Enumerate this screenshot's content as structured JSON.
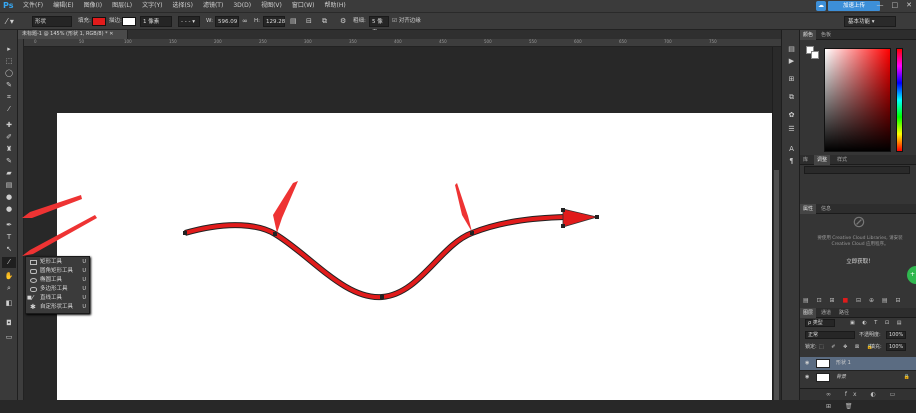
{
  "menubar": {
    "logo": "Ps",
    "items": [
      "文件(F)",
      "编辑(E)",
      "图像(I)",
      "图层(L)",
      "文字(Y)",
      "选择(S)",
      "滤镜(T)",
      "3D(D)",
      "视图(V)",
      "窗口(W)",
      "帮助(H)"
    ],
    "cloud_button": "加速上传",
    "window_controls": [
      "—",
      "□",
      "✕"
    ]
  },
  "options": {
    "mode": "形状",
    "fill_label": "填充:",
    "stroke_label": "描边:",
    "stroke_size": "1 像素",
    "w_label": "W:",
    "w_value": "596.09",
    "h_label": "H:",
    "h_value": "129.28",
    "weight_label": "粗细:",
    "weight_value": "5 像素",
    "align_edges": "对齐边缘",
    "workspace": "基本功能",
    "fill_color": "#e11b1b",
    "stroke_color": "#ffffff"
  },
  "document": {
    "tab_title": "未标题-1 @ 145% (形状 1, RGB/8) *",
    "ruler_ticks": [
      "0",
      "50",
      "100",
      "150",
      "200",
      "250",
      "300",
      "350",
      "400",
      "450",
      "500",
      "550",
      "600",
      "650",
      "700",
      "750"
    ]
  },
  "flyout": {
    "items": [
      {
        "label": "矩形工具",
        "key": "U"
      },
      {
        "label": "圆角矩形工具",
        "key": "U"
      },
      {
        "label": "椭圆工具",
        "key": "U"
      },
      {
        "label": "多边形工具",
        "key": "U"
      },
      {
        "label": "直线工具",
        "key": "U"
      },
      {
        "label": "自定形状工具",
        "key": "U"
      }
    ]
  },
  "panels": {
    "color_tabs": [
      "颜色",
      "色板"
    ],
    "adjust_tabs": [
      "库",
      "调整",
      "样式"
    ],
    "lib_tabs": [
      "属性",
      "信息"
    ],
    "lib_message": "要使用 Creative Cloud Libraries, 请安装 Creative Cloud 应用程序。",
    "lib_link": "立即获取！",
    "layers_tabs": [
      "图层",
      "通道",
      "路径"
    ],
    "kind_filter": "ρ 类型",
    "blend_mode": "正常",
    "opacity_label": "不透明度:",
    "opacity_value": "100%",
    "lock_label": "锁定:",
    "fill_label": "填充:",
    "fill_value": "100%",
    "layers": [
      {
        "name": "形状 1",
        "selected": true
      },
      {
        "name": "背景",
        "selected": false
      }
    ]
  }
}
